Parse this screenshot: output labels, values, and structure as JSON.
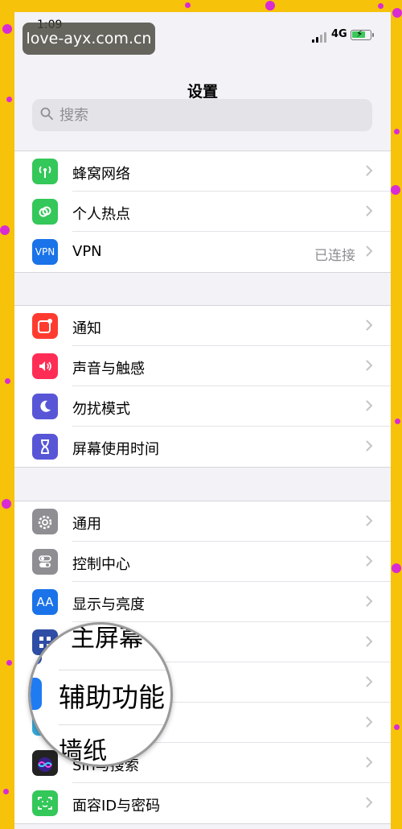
{
  "watermark": "love-ayx.com.cn",
  "status": {
    "time": "1:09",
    "network": "4G"
  },
  "title": "设置",
  "search": {
    "placeholder": "搜索"
  },
  "groups": [
    [
      {
        "label": "蜂窝网络",
        "icon": "antenna-icon",
        "color": "#34c759"
      },
      {
        "label": "个人热点",
        "icon": "hotspot-icon",
        "color": "#34c759"
      },
      {
        "label": "VPN",
        "icon_text": "VPN",
        "icon": "vpn-icon",
        "color": "#1a73e8",
        "value": "已连接"
      }
    ],
    [
      {
        "label": "通知",
        "icon": "notification-icon",
        "color": "#ff3b30"
      },
      {
        "label": "声音与触感",
        "icon": "speaker-icon",
        "color": "#ff2d55"
      },
      {
        "label": "勿扰模式",
        "icon": "moon-icon",
        "color": "#5856d6"
      },
      {
        "label": "屏幕使用时间",
        "icon": "hourglass-icon",
        "color": "#5856d6"
      }
    ],
    [
      {
        "label": "通用",
        "icon": "gear-icon",
        "color": "#8e8e93"
      },
      {
        "label": "控制中心",
        "icon": "toggles-icon",
        "color": "#8e8e93"
      },
      {
        "label": "显示与亮度",
        "icon_text": "AA",
        "icon": "display-icon",
        "color": "#1a73e8"
      },
      {
        "label": "主屏幕",
        "icon": "home-screen-icon",
        "color": "#2e4ea6"
      },
      {
        "label": "辅助功能",
        "icon": "accessibility-icon",
        "color": "#1a73e8"
      },
      {
        "label": "墙纸",
        "icon": "wallpaper-icon",
        "color": "#36aadc"
      },
      {
        "label": "Siri与搜索",
        "icon": "siri-icon",
        "color": "#222222"
      },
      {
        "label": "面容ID与密码",
        "icon": "face-id-icon",
        "color": "#34c759"
      }
    ]
  ],
  "magnifier": {
    "top": "主屏幕",
    "main": "辅助功能",
    "bottom": "墙纸"
  }
}
